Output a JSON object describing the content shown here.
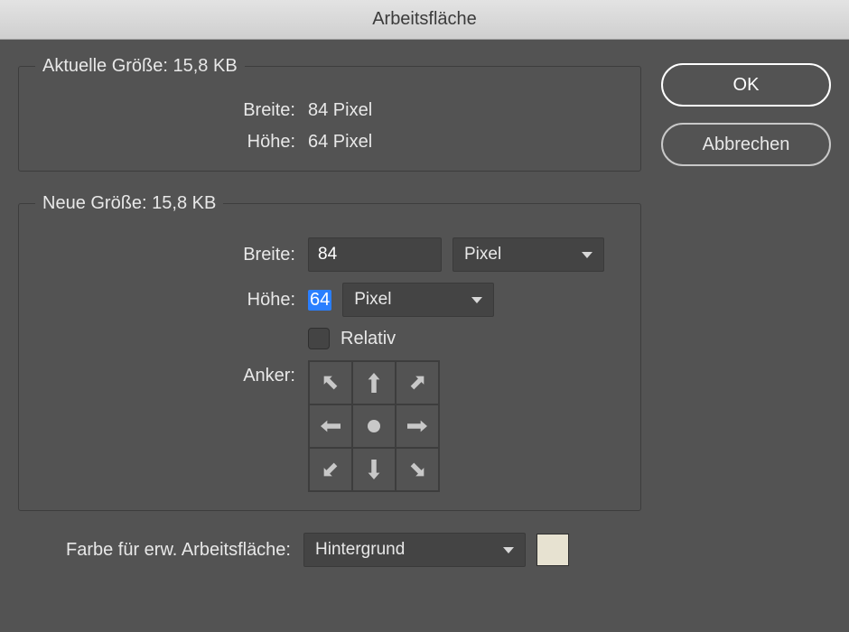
{
  "title": "Arbeitsfläche",
  "buttons": {
    "ok": "OK",
    "cancel": "Abbrechen"
  },
  "current": {
    "legend": "Aktuelle Größe: 15,8 KB",
    "width_label": "Breite:",
    "width_value": "84 Pixel",
    "height_label": "Höhe:",
    "height_value": "64 Pixel"
  },
  "new": {
    "legend": "Neue Größe: 15,8 KB",
    "width_label": "Breite:",
    "width_value": "84",
    "width_unit": "Pixel",
    "height_label": "Höhe:",
    "height_value": "64",
    "height_unit": "Pixel",
    "relative_label": "Relativ",
    "anchor_label": "Anker:"
  },
  "extension": {
    "label": "Farbe für erw. Arbeitsfläche:",
    "value": "Hintergrund",
    "swatch_color": "#e7e2d1"
  }
}
